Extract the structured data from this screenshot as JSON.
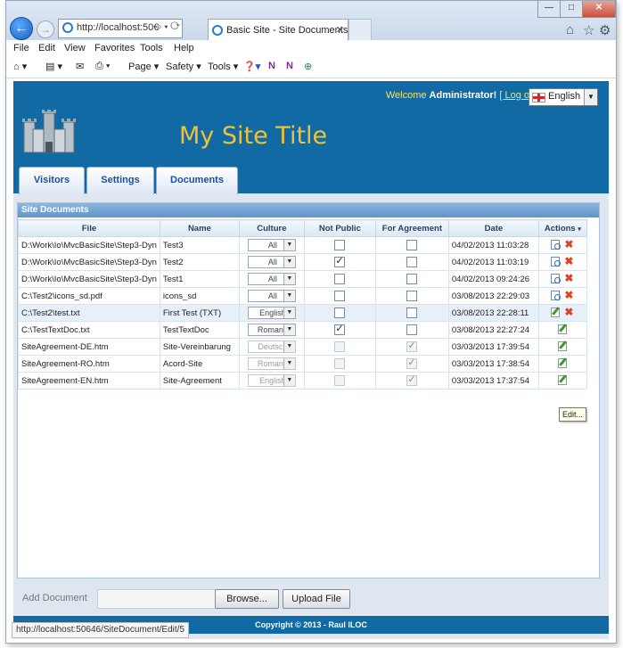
{
  "browser": {
    "address_url": "http://localhost:50€",
    "tab_title": "Basic Site - Site Documents",
    "menu": [
      "File",
      "Edit",
      "View",
      "Favorites",
      "Tools",
      "Help"
    ],
    "commands": [
      "Page",
      "Safety",
      "Tools"
    ],
    "status_url": "http://localhost:50646/SiteDocument/Edit/5"
  },
  "header": {
    "welcome_prefix": "Welcome",
    "user": "Administrator!",
    "logoff": "[ Log off]",
    "language": "English",
    "site_title": "My Site Title"
  },
  "nav": {
    "tabs": [
      "Visitors",
      "Settings",
      "Documents"
    ]
  },
  "panel": {
    "title": "Site Documents",
    "columns": [
      "File",
      "Name",
      "Culture",
      "Not Public",
      "For Agreement",
      "Date",
      "Actions"
    ],
    "rows": [
      {
        "file": "D:\\Work\\Io\\MvcBasicSite\\Step3-Dyn",
        "name": "Test3",
        "culture": "All",
        "not_public": false,
        "for_agreement": false,
        "date": "04/02/2013 11:03:28",
        "disabled": false,
        "actions": "view-delete"
      },
      {
        "file": "D:\\Work\\Io\\MvcBasicSite\\Step3-Dyn",
        "name": "Test2",
        "culture": "All",
        "not_public": true,
        "for_agreement": false,
        "date": "04/02/2013 11:03:19",
        "disabled": false,
        "actions": "view-delete"
      },
      {
        "file": "D:\\Work\\Io\\MvcBasicSite\\Step3-Dyn",
        "name": "Test1",
        "culture": "All",
        "not_public": false,
        "for_agreement": false,
        "date": "04/02/2013 09:24:26",
        "disabled": false,
        "actions": "view-delete"
      },
      {
        "file": "C:\\Test2\\icons_sd.pdf",
        "name": "icons_sd",
        "culture": "All",
        "not_public": false,
        "for_agreement": false,
        "date": "03/08/2013 22:29:03",
        "disabled": false,
        "actions": "view-delete"
      },
      {
        "file": "C:\\Test2\\test.txt",
        "name": "First Test (TXT)",
        "culture": "English",
        "not_public": false,
        "for_agreement": false,
        "date": "03/08/2013 22:28:11",
        "disabled": false,
        "actions": "edit-delete"
      },
      {
        "file": "C:\\TestTextDoc.txt",
        "name": "TestTextDoc",
        "culture": "Romana",
        "not_public": true,
        "for_agreement": false,
        "date": "03/08/2013 22:27:24",
        "disabled": false,
        "actions": "edit"
      },
      {
        "file": "SiteAgreement-DE.htm",
        "name": "Site-Vereinbarung",
        "culture": "Deutsch",
        "not_public": false,
        "for_agreement": true,
        "date": "03/03/2013 17:39:54",
        "disabled": true,
        "actions": "edit"
      },
      {
        "file": "SiteAgreement-RO.htm",
        "name": "Acord-Site",
        "culture": "Romana",
        "not_public": false,
        "for_agreement": true,
        "date": "03/03/2013 17:38:54",
        "disabled": true,
        "actions": "edit"
      },
      {
        "file": "SiteAgreement-EN.htm",
        "name": "Site-Agreement",
        "culture": "English",
        "not_public": false,
        "for_agreement": true,
        "date": "03/03/2013 17:37:54",
        "disabled": true,
        "actions": "edit"
      }
    ],
    "tooltip": "Edit..."
  },
  "upload": {
    "label": "Add Document",
    "browse": "Browse...",
    "upload": "Upload File"
  },
  "footer": {
    "copyright": "Copyright © 2013 - Raul ILOC"
  },
  "colors": {
    "brand_blue": "#116aa3",
    "title_gold": "#f1c232",
    "welcome_yellow": "#f3e36a"
  }
}
